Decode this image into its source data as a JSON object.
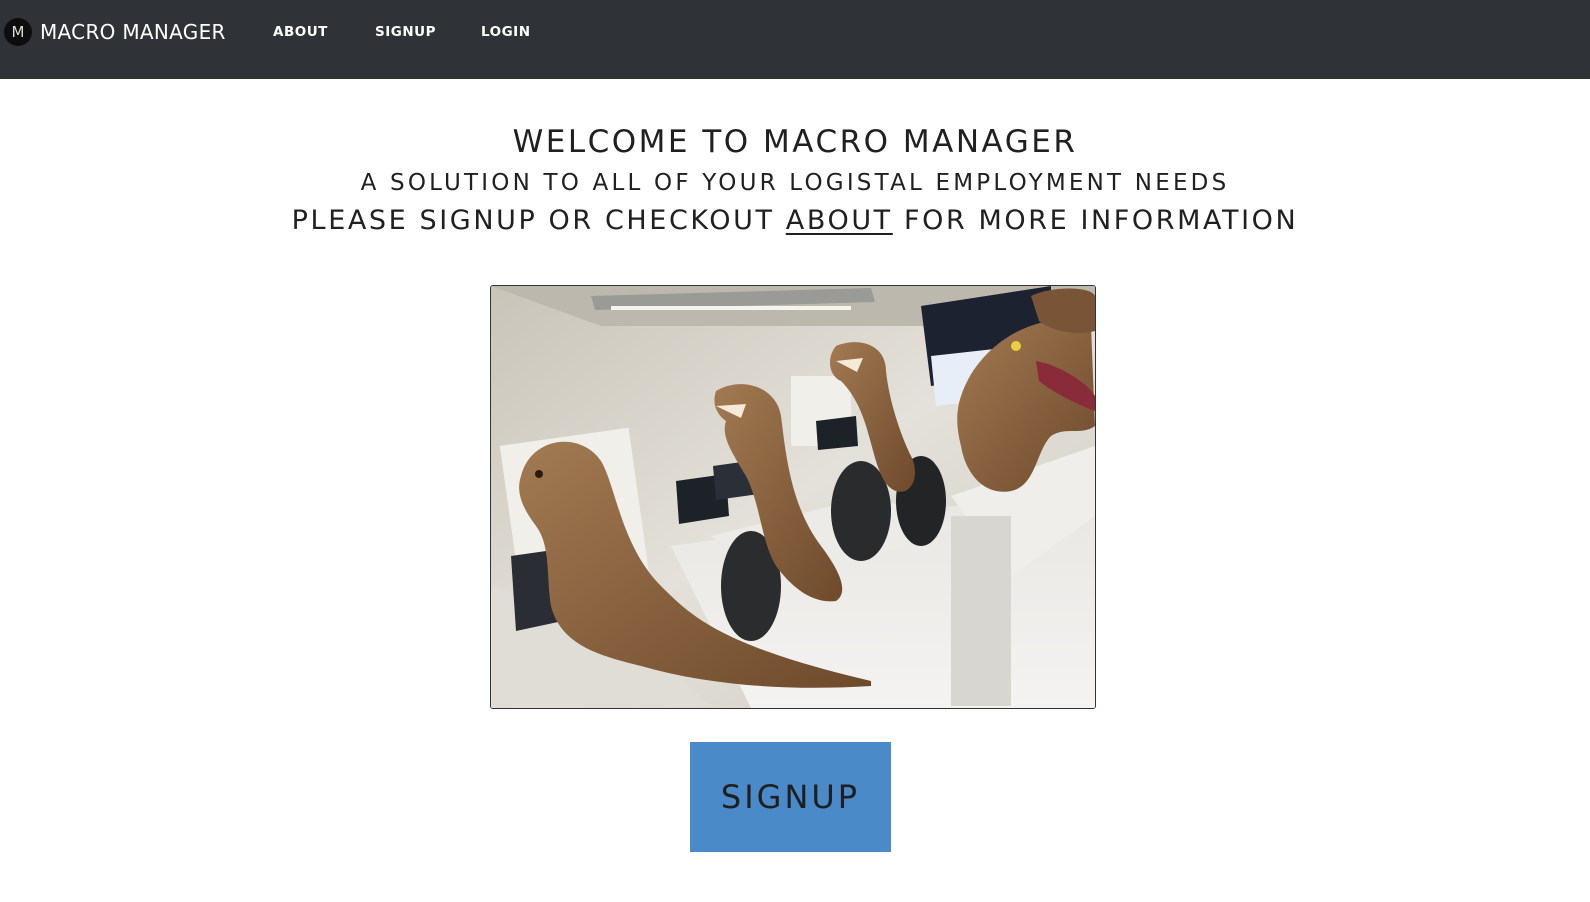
{
  "navbar": {
    "logo_letter": "M",
    "brand": "MACRO MANAGER",
    "links": [
      {
        "label": "ABOUT"
      },
      {
        "label": "SIGNUP"
      },
      {
        "label": "LOGIN"
      }
    ],
    "background": "#2f3337"
  },
  "hero": {
    "title": "WELCOME TO MACRO MANAGER",
    "subtitle": "A SOLUTION TO ALL OF YOUR LOGISTAL EMPLOYMENT NEEDS",
    "cta_line": {
      "before": "PLEASE SIGNUP OR CHECKOUT ",
      "link": "ABOUT",
      "after": " FOR MORE INFORMATION"
    },
    "image_icon": "office-dinosaurs-photo",
    "button_label": "SIGNUP",
    "button_color": "#4a8ac9"
  }
}
